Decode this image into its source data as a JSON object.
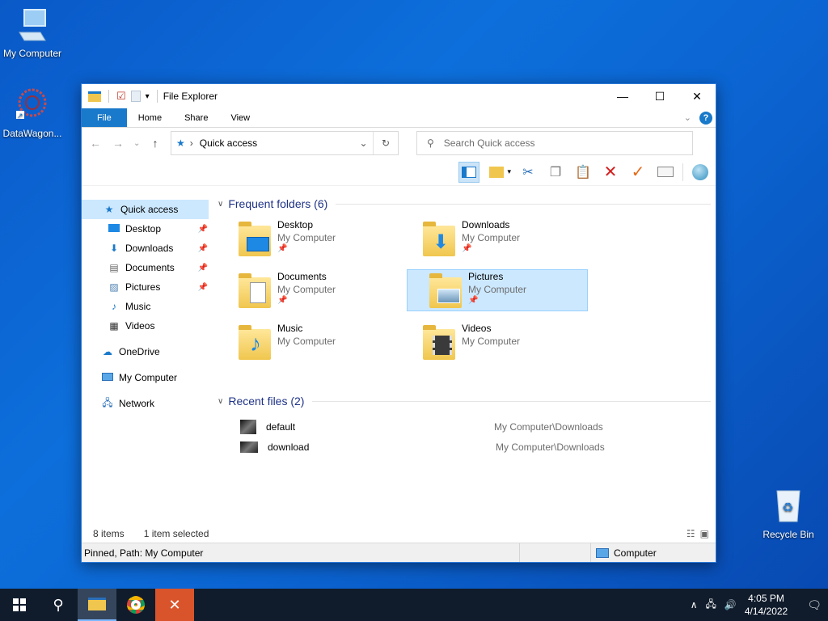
{
  "desktop": {
    "icons": [
      {
        "label": "My Computer"
      },
      {
        "label": "DataWagon..."
      },
      {
        "label": "Recycle Bin"
      }
    ]
  },
  "window": {
    "title": "File Explorer",
    "controls": {
      "minimize": "—",
      "maximize": "☐",
      "close": "✕"
    }
  },
  "ribbon": {
    "tabs": [
      "File",
      "Home",
      "Share",
      "View"
    ],
    "help": "?"
  },
  "nav": {
    "back": "←",
    "forward": "→",
    "recent": "⌄",
    "up": "↑",
    "address": "Quick access",
    "search_placeholder": "Search Quick access"
  },
  "sidebar": {
    "items": [
      {
        "label": "Quick access"
      },
      {
        "label": "Desktop"
      },
      {
        "label": "Downloads"
      },
      {
        "label": "Documents"
      },
      {
        "label": "Pictures"
      },
      {
        "label": "Music"
      },
      {
        "label": "Videos"
      },
      {
        "label": "OneDrive"
      },
      {
        "label": "My Computer"
      },
      {
        "label": "Network"
      }
    ]
  },
  "frequent": {
    "heading": "Frequent folders (6)",
    "folders": [
      {
        "name": "Desktop",
        "location": "My Computer"
      },
      {
        "name": "Downloads",
        "location": "My Computer"
      },
      {
        "name": "Documents",
        "location": "My Computer"
      },
      {
        "name": "Pictures",
        "location": "My Computer"
      },
      {
        "name": "Music",
        "location": "My Computer"
      },
      {
        "name": "Videos",
        "location": "My Computer"
      }
    ]
  },
  "recent": {
    "heading": "Recent files (2)",
    "files": [
      {
        "name": "default",
        "path": "My Computer\\Downloads"
      },
      {
        "name": "download",
        "path": "My Computer\\Downloads"
      }
    ]
  },
  "status": {
    "items": "8 items",
    "selected": "1 item selected",
    "detail": "Pinned, Path: My Computer",
    "location": "Computer"
  },
  "taskbar": {
    "time": "4:05 PM",
    "date": "4/14/2022"
  },
  "colors": {
    "accent": "#1979ca",
    "selection": "#cce8ff",
    "heading": "#1e3287"
  }
}
